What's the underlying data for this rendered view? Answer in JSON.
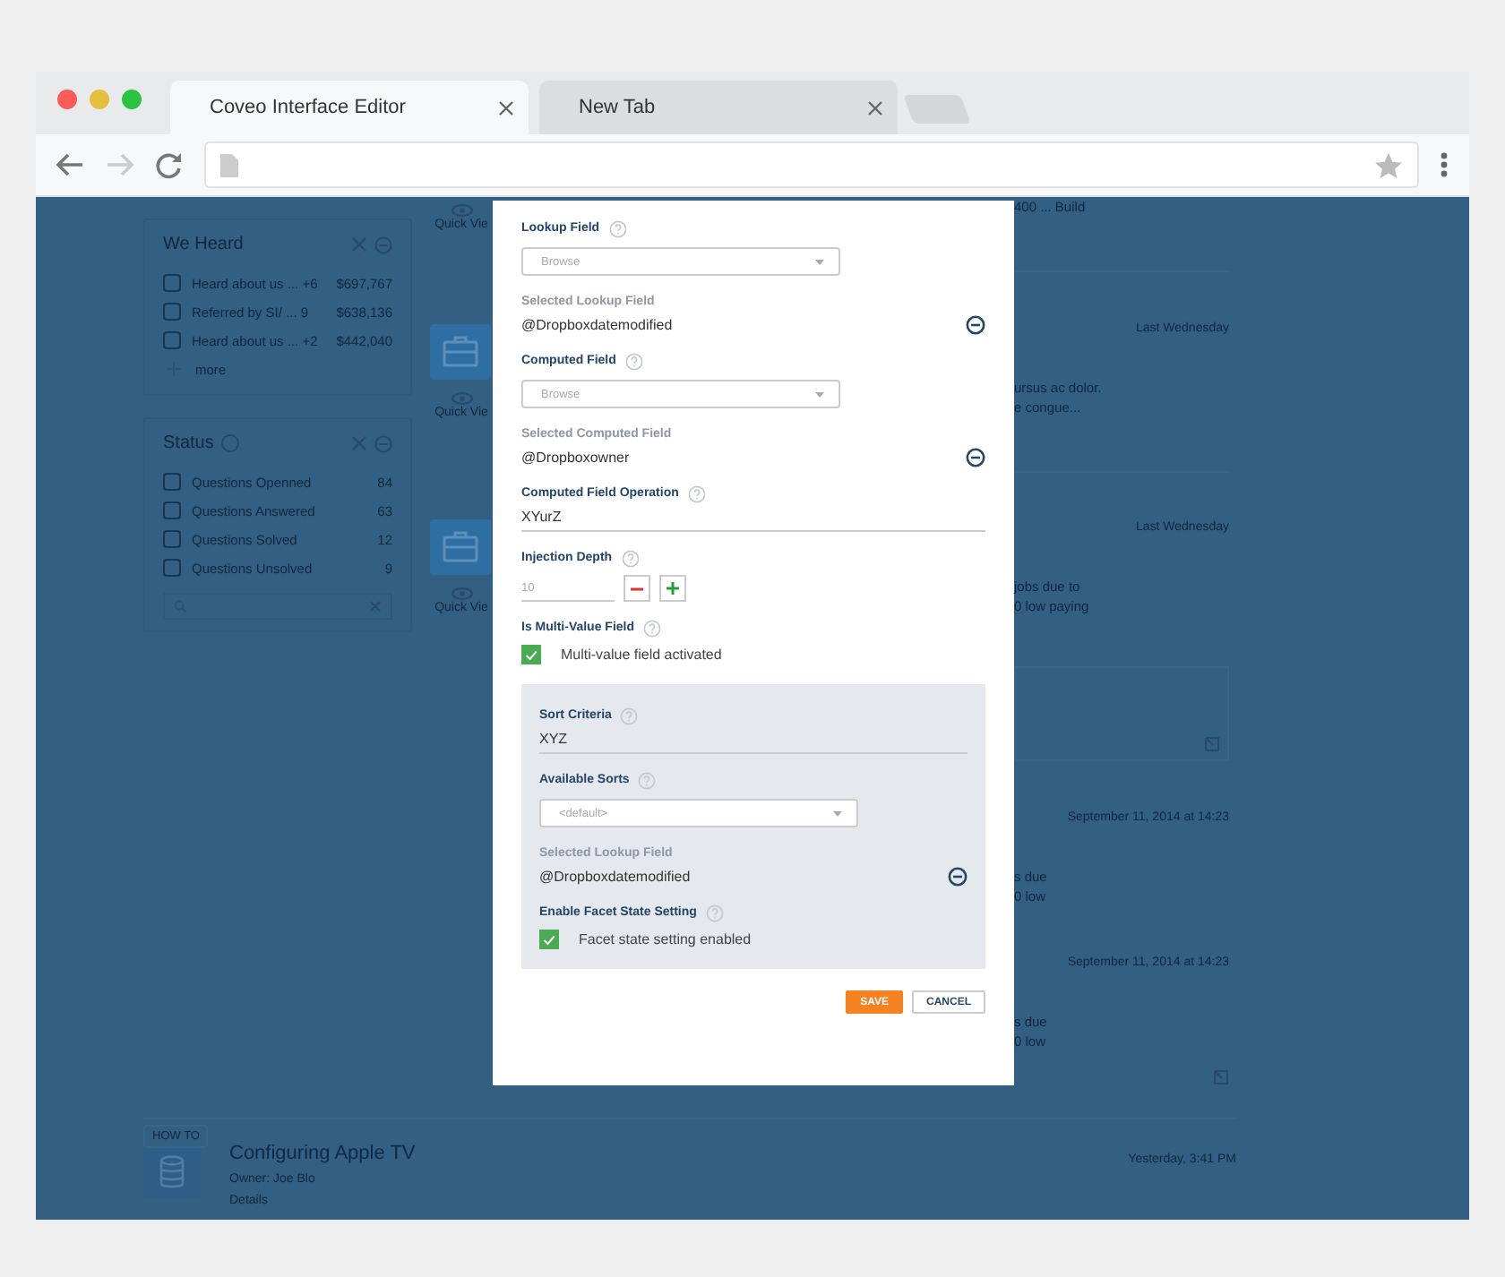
{
  "browser": {
    "tabs": [
      {
        "title": "Coveo Interface Editor",
        "selected": true
      },
      {
        "title": "New Tab",
        "selected": false
      }
    ]
  },
  "facets": [
    {
      "title": "We Heard",
      "title_icon": false,
      "rows": [
        {
          "label": "Heard about us ... +6",
          "value": "$697,767",
          "checked": false
        },
        {
          "label": "Referred by SI/ ... 9",
          "value": "$638,136",
          "checked": false
        },
        {
          "label": "Heard about us ... +2",
          "value": "$442,040",
          "checked": false
        }
      ],
      "more": "more",
      "search": false
    },
    {
      "title": "Status",
      "title_icon": true,
      "rows": [
        {
          "label": "Questions Openned",
          "value": "84",
          "checked": false
        },
        {
          "label": "Questions Answered",
          "value": "63",
          "checked": false
        },
        {
          "label": "Questions Solved",
          "value": "12",
          "checked": false
        },
        {
          "label": "Questions Unsolved",
          "value": "9",
          "checked": false
        }
      ],
      "search": true
    }
  ],
  "result_icons": [
    {
      "tile": false,
      "label": "Quick Vie"
    },
    {
      "tile": true,
      "label": "Quick Vie"
    },
    {
      "tile": true,
      "label": "Quick Vie"
    }
  ],
  "result_fragments": [
    {
      "kind": "snippet",
      "lines": [
        "400 ... Build"
      ]
    },
    {
      "kind": "divider"
    },
    {
      "kind": "date",
      "text": "Last Wednesday"
    },
    {
      "kind": "snippet",
      "lines": [
        "ursus ac dolor.",
        "e congue..."
      ]
    },
    {
      "kind": "divider"
    },
    {
      "kind": "date",
      "text": "Last Wednesday"
    },
    {
      "kind": "snippet",
      "lines": [
        "jobs due to",
        "0 low paying"
      ]
    },
    {
      "kind": "preview"
    },
    {
      "kind": "date",
      "text": "September 11, 2014 at 14:23"
    },
    {
      "kind": "snippet",
      "lines": [
        "s due",
        "0 low"
      ]
    },
    {
      "kind": "date",
      "text": "September 11, 2014 at 14:23"
    },
    {
      "kind": "snippet",
      "lines": [
        "s due",
        "0 low"
      ]
    },
    {
      "kind": "icon"
    }
  ],
  "bottom_result": {
    "tag": "HOW TO",
    "title": "Configuring Apple TV",
    "owner": "Owner: Joe Blo",
    "link": "Details",
    "date": "Yesterday, 3:41 PM"
  },
  "modal": {
    "fields": [
      {
        "kind": "dropdown",
        "label": "Lookup Field",
        "help": true,
        "placeholder": "Browse"
      },
      {
        "kind": "selected",
        "label": "Selected Lookup Field",
        "value": "@Dropboxdatemodified"
      },
      {
        "kind": "dropdown",
        "label": "Computed Field",
        "help": true,
        "placeholder": "Browse"
      },
      {
        "kind": "selected",
        "label": "Selected Computed Field",
        "value": "@Dropboxowner"
      },
      {
        "kind": "text",
        "label": "Computed Field Operation",
        "help": true,
        "value": "XYurZ"
      },
      {
        "kind": "stepper",
        "label": "Injection Depth",
        "help": true,
        "placeholder": "10"
      },
      {
        "kind": "checkbox",
        "label": "Is Multi-Value Field",
        "help": true,
        "option": "Multi-value field activated",
        "checked": true
      },
      {
        "kind": "panel",
        "fields": [
          {
            "kind": "text",
            "label": "Sort Criteria",
            "help": true,
            "value": "XYZ"
          },
          {
            "kind": "dropdown",
            "label": "Available Sorts",
            "help": true,
            "placeholder": "<default>"
          },
          {
            "kind": "selected",
            "label": "Selected Lookup Field",
            "value": "@Dropboxdatemodified"
          },
          {
            "kind": "checkbox",
            "label": "Enable Facet State Setting",
            "help": true,
            "option": "Facet state setting enabled",
            "checked": true
          }
        ]
      }
    ],
    "buttons": [
      {
        "label": "SAVE",
        "kind": "primary"
      },
      {
        "label": "CANCEL",
        "kind": "secondary"
      }
    ]
  }
}
